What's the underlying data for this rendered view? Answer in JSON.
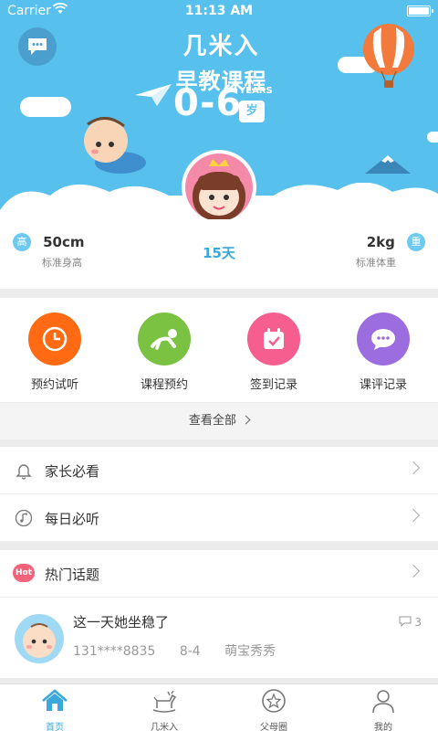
{
  "status_bar": {
    "carrier": "Carrier",
    "time": "11:13 AM"
  },
  "brand": {
    "line1": "几米入",
    "line2": "早教课程",
    "age_range": "0-6",
    "years": "YEARS",
    "unit": "岁"
  },
  "stats": {
    "height_value": "50cm",
    "height_badge": "高",
    "height_label": "标准身高",
    "age_days": "15天",
    "weight_value": "2kg",
    "weight_badge": "重",
    "weight_label": "标准体重"
  },
  "actions": [
    {
      "label": "预约试听",
      "icon": "clock-icon",
      "color": "#ff6a13"
    },
    {
      "label": "课程预约",
      "icon": "crawling-baby-icon",
      "color": "#7bc142"
    },
    {
      "label": "签到记录",
      "icon": "calendar-check-icon",
      "color": "#f55e8e"
    },
    {
      "label": "课评记录",
      "icon": "chat-dots-icon",
      "color": "#9b6ddf"
    }
  ],
  "view_all": "查看全部",
  "menu": [
    {
      "label": "家长必看",
      "icon": "bell-icon"
    },
    {
      "label": "每日必听",
      "icon": "music-note-icon"
    }
  ],
  "hot_topics": {
    "tag": "Hot",
    "label": "热门话题"
  },
  "post": {
    "title": "这一天她坐稳了",
    "phone": "131****8835",
    "date": "8-4",
    "author": "萌宝秀秀",
    "comment_count": "3"
  },
  "tabs": [
    {
      "label": "首页",
      "icon": "home-icon",
      "active": true
    },
    {
      "label": "几米入",
      "icon": "rocking-horse-icon",
      "active": false
    },
    {
      "label": "父母圈",
      "icon": "star-circle-icon",
      "active": false
    },
    {
      "label": "我的",
      "icon": "user-icon",
      "active": false
    }
  ],
  "colors": {
    "sky": "#57c0ec",
    "accent": "#3aa8db"
  }
}
